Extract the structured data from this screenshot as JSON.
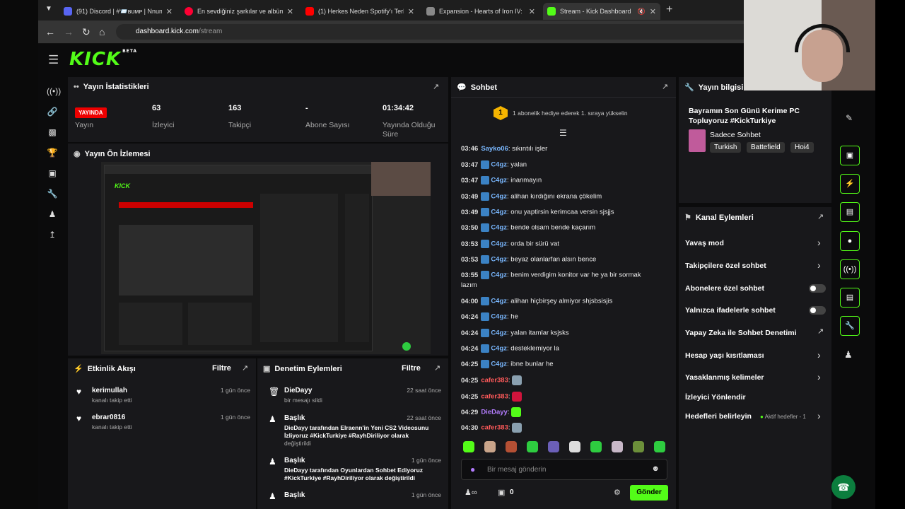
{
  "browser": {
    "tabs": [
      {
        "title": "(91) Discord | #📨ʙᴜᴍᴘ | Nnum"
      },
      {
        "title": "En sevdiğiniz şarkılar ve albümle"
      },
      {
        "title": "(1) Herkes Neden Spotify'ı Terk"
      },
      {
        "title": "Expansion - Hearts of Iron IV: N"
      },
      {
        "title": "Stream - Kick Dashboard"
      }
    ],
    "url_host": "dashboard.kick.com",
    "url_path": "/stream"
  },
  "header": {
    "logo": "KICK",
    "beta": "BETA"
  },
  "stats": {
    "title": "Yayın İstatistikleri",
    "live_badge": "YAYINDA",
    "live_label": "Yayın",
    "viewers_value": "63",
    "viewers_label": "İzleyici",
    "followers_value": "163",
    "followers_label": "Takipçi",
    "subs_value": "-",
    "subs_label": "Abone Sayısı",
    "duration_value": "01:34:42",
    "duration_label": "Yayında Olduğu Süre"
  },
  "preview": {
    "title": "Yayın Ön İzlemesi"
  },
  "activity": {
    "title": "Etkinlik Akışı",
    "filter": "Filtre",
    "items": [
      {
        "name": "kerimullah",
        "desc": "kanalı takip etti",
        "time": "1 gün önce"
      },
      {
        "name": "ebrar0816",
        "desc": "kanalı takip etti",
        "time": "1 gün önce"
      }
    ]
  },
  "moderation": {
    "title": "Denetim Eylemleri",
    "filter": "Filtre",
    "items": [
      {
        "name": "DieDayy",
        "desc": "bir mesajı sildi",
        "time": "22 saat önce"
      },
      {
        "name": "Başlık",
        "desc1": "DieDayy tarafından Elraenn'in Yeni CS2 Videosunu",
        "desc2": "İzliyoruz #KickTurkiye #RayhDiriliyor olarak",
        "desc3": "değiştirildi",
        "time": "22 saat önce"
      },
      {
        "name": "Başlık",
        "desc1": "DieDayy tarafından Oyunlardan Sohbet Ediyoruz",
        "desc2": "#KickTurkiye #RayhDiriliyor olarak değiştirildi",
        "time": "1 gün önce"
      },
      {
        "name": "Başlık",
        "time": "1 gün önce"
      }
    ]
  },
  "chat": {
    "title": "Sohbet",
    "pinned_rank": "1",
    "pinned_text": "1 abonelik hediye ederek 1. sıraya yükselin",
    "messages": [
      {
        "time": "03:46",
        "user": "Sayko06",
        "text": "sıkıntılı işler",
        "color": "#7ab8ff"
      },
      {
        "time": "03:47",
        "user": "C4gz",
        "text": "yalan",
        "color": "#7ab8ff"
      },
      {
        "time": "03:47",
        "user": "C4gz",
        "text": "inanmayın",
        "color": "#7ab8ff"
      },
      {
        "time": "03:49",
        "user": "C4gz",
        "text": "alihan kırdığını ekrana çökelim",
        "color": "#7ab8ff"
      },
      {
        "time": "03:49",
        "user": "C4gz",
        "text": "onu yaptirsin kerimcaa versin sjsjjs",
        "color": "#7ab8ff"
      },
      {
        "time": "03:50",
        "user": "C4gz",
        "text": "bende olsam bende kaçarım",
        "color": "#7ab8ff"
      },
      {
        "time": "03:53",
        "user": "C4gz",
        "text": "orda bir sürü vat",
        "color": "#7ab8ff"
      },
      {
        "time": "03:53",
        "user": "C4gz",
        "text": "beyaz olanlarfan alsın bence",
        "color": "#7ab8ff"
      },
      {
        "time": "03:55",
        "user": "C4gz",
        "text": "benim verdigim konitor var he ya bir sormak",
        "text2": "lazım",
        "color": "#7ab8ff"
      },
      {
        "time": "04:00",
        "user": "C4gz",
        "text": "alihan hiçbirşey almiyor shjsbsisjis",
        "color": "#7ab8ff"
      },
      {
        "time": "04:24",
        "user": "C4gz",
        "text": "he",
        "color": "#7ab8ff"
      },
      {
        "time": "04:24",
        "user": "C4gz",
        "text": "yalan itamlar ksjsks",
        "color": "#7ab8ff"
      },
      {
        "time": "04:24",
        "user": "C4gz",
        "text": "desteklemiyor la",
        "color": "#7ab8ff"
      },
      {
        "time": "04:25",
        "user": "C4gz",
        "text": "ibne bunlar he",
        "color": "#7ab8ff"
      },
      {
        "time": "04:25",
        "user": "cafer383",
        "text": "",
        "color": "#ff5a5a"
      },
      {
        "time": "04:25",
        "user": "cafer383",
        "text": "",
        "color": "#ff5a5a"
      },
      {
        "time": "04:29",
        "user": "DieDayy",
        "text": "",
        "color": "#b47dff"
      },
      {
        "time": "04:30",
        "user": "cafer383",
        "text": "",
        "color": "#ff5a5a"
      }
    ],
    "input_placeholder": "Bir mesaj gönderin",
    "points": "0",
    "send": "Gönder"
  },
  "info": {
    "title": "Yayın bilgisi",
    "stream_title_1": "Bayramın Son Günü Kerime PC",
    "stream_title_2": "Topluyoruz #KickTurkiye",
    "category": "Sadece Sohbet",
    "tags": [
      "Turkish",
      "Battefield",
      "Hoi4"
    ]
  },
  "channel_actions": {
    "title": "Kanal Eylemleri",
    "slow_mode": "Yavaş mod",
    "followers_only": "Takipçilere özel sohbet",
    "subs_only": "Abonelere özel sohbet",
    "emotes_only": "Yalnızca ifadelerle sohbet",
    "ai_moderation": "Yapay Zeka ile Sohbet Denetimi",
    "account_age": "Hesap yaşı kısıtlaması",
    "banned_words": "Yasaklanmış kelimeler",
    "redirect": "İzleyici Yönlendir",
    "goals": "Hedefleri belirleyin",
    "goals_status": "Aktif hedefler - 1"
  },
  "colors": {
    "accent": "#53fc18",
    "live": "#e00000",
    "panel": "#18181b"
  }
}
